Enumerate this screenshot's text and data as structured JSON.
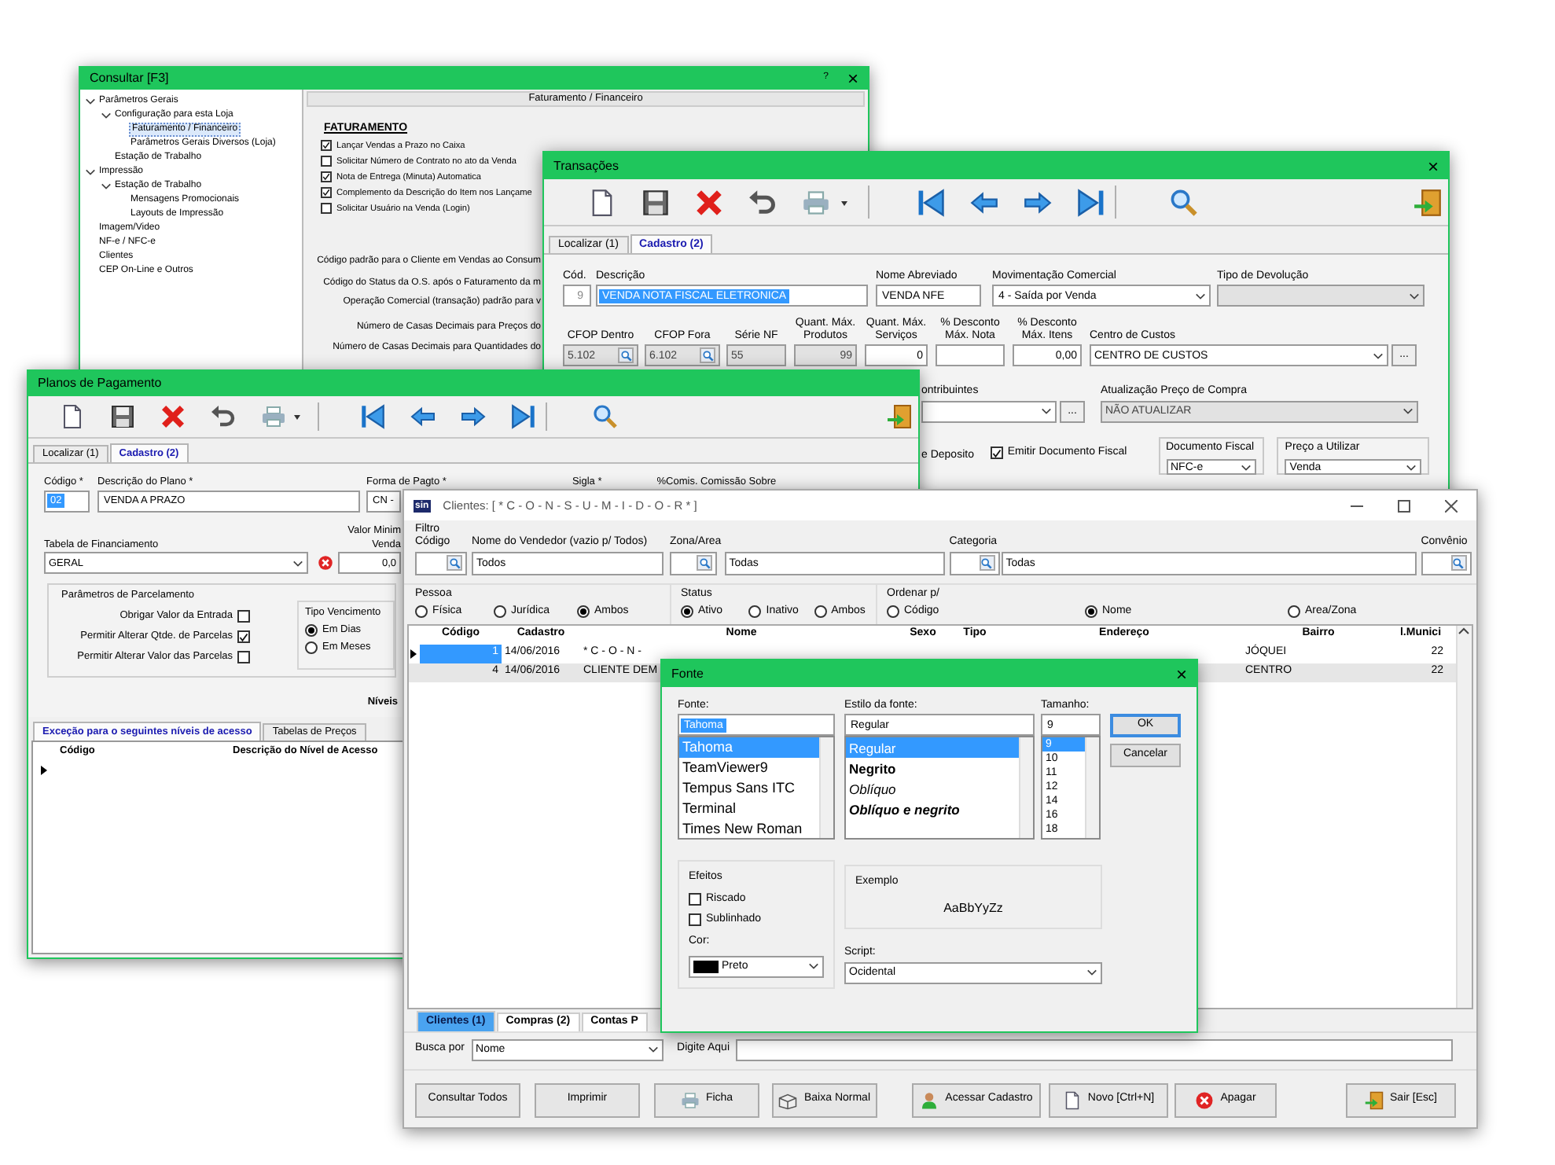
{
  "consultar": {
    "title": "Consultar [F3]",
    "help": "?",
    "close": "×",
    "tree": [
      {
        "label": "Parâmetros Gerais",
        "expanded": true,
        "selected": false,
        "children": [
          {
            "label": "Configuração para esta Loja",
            "expanded": true,
            "selected": false,
            "children": [
              {
                "label": "Faturamento / Financeiro",
                "selected": true
              },
              {
                "label": "Parâmetros Gerais Diversos (Loja)",
                "selected": false
              }
            ]
          },
          {
            "label": "Estação de Trabalho",
            "selected": false
          }
        ]
      },
      {
        "label": "Impressão",
        "expanded": true,
        "selected": false,
        "children": [
          {
            "label": "Estação de Trabalho",
            "expanded": true,
            "selected": false,
            "children": [
              {
                "label": "Mensagens Promocionais",
                "selected": false
              },
              {
                "label": "Layouts de Impressão",
                "selected": false
              }
            ]
          }
        ]
      },
      {
        "label": "Imagem/Video",
        "selected": false
      },
      {
        "label": "NF-e / NFC-e",
        "selected": false
      },
      {
        "label": "Clientes",
        "selected": false
      },
      {
        "label": "CEP On-Line e Outros",
        "selected": false
      }
    ],
    "panel_title": "Faturamento / Financeiro",
    "section": "FATURAMENTO",
    "options": [
      {
        "label": "Lançar Vendas a Prazo no Caixa",
        "checked": true
      },
      {
        "label": "Solicitar Número de Contrato no ato da Venda",
        "checked": false
      },
      {
        "label": "Nota de Entrega (Minuta) Automatica",
        "checked": true
      },
      {
        "label": "Complemento da Descrição do Item nos Lançame",
        "checked": true
      },
      {
        "label": "Solicitar Usuário na Venda (Login)",
        "checked": false
      }
    ],
    "settings": [
      "Código padrão para o Cliente em Vendas ao Consum",
      "Código do Status da O.S. após o Faturamento da m",
      "Operação Comercial (transação) padrão para v",
      "Número de Casas Decimais para Preços do",
      "Número de Casas Decimais para Quantidades do"
    ]
  },
  "transacoes": {
    "title": "Transações",
    "close": "×",
    "tabs": [
      {
        "label": "Localizar (1)",
        "selected": false
      },
      {
        "label": "Cadastro (2)",
        "selected": true
      }
    ],
    "row_1": [
      {
        "label": "Cód.",
        "value": "9",
        "kind": "readonly",
        "disabled": false,
        "highlighted": false
      },
      {
        "label": "Descrição",
        "value": "VENDA NOTA FISCAL ELETRONICA",
        "kind": "text",
        "disabled": false,
        "highlighted": true
      },
      {
        "label": "Nome Abreviado",
        "value": "VENDA NFE",
        "kind": "text",
        "disabled": false,
        "highlighted": false
      },
      {
        "label": "Movimentação Comercial",
        "value": "4 - Saída por Venda",
        "kind": "select",
        "disabled": false,
        "highlighted": false
      },
      {
        "label": "Tipo de Devolução",
        "kind": "select",
        "disabled": true
      }
    ],
    "row_2": [
      {
        "label": "CFOP Dentro",
        "value": "5.102",
        "kind": "lookup",
        "disabled": true
      },
      {
        "label": "CFOP Fora",
        "value": "6.102",
        "kind": "lookup",
        "disabled": true
      },
      {
        "label": "Série NF",
        "value": "55",
        "kind": "text",
        "disabled": true
      },
      {
        "label": "Quant. Máx. Produtos",
        "value": "99",
        "kind": "number",
        "disabled": true
      },
      {
        "label": "Quant. Máx. Serviços",
        "value": "0",
        "kind": "number",
        "disabled": false
      },
      {
        "label": "% Desconto Máx. Nota",
        "kind": "number",
        "disabled": false
      },
      {
        "label": "% Desconto Máx. Itens",
        "value": "0,00",
        "kind": "number",
        "disabled": false
      },
      {
        "label": "Centro de Custos",
        "value": "CENTRO DE CUSTOS",
        "kind": "select",
        "disabled": false,
        "button": "..."
      }
    ],
    "row_3": [
      {
        "label": "ontribuintes",
        "kind": "select",
        "disabled": false,
        "button": "..."
      },
      {
        "label": "Atualização Preço de Compra",
        "value": "NÃO ATUALIZAR",
        "kind": "select",
        "disabled": true
      }
    ],
    "row_4": {
      "caption": "e Deposito",
      "checkbox": {
        "label": "Emitir Documento Fiscal",
        "checked": true
      },
      "groups": [
        {
          "label": "Documento Fiscal",
          "value": "NFC-e"
        },
        {
          "label": "Preço a Utilizar",
          "value": "Venda"
        }
      ]
    }
  },
  "planos": {
    "title": "Planos de Pagamento",
    "tabs": [
      {
        "label": "Localizar (1)",
        "selected": false
      },
      {
        "label": "Cadastro (2)",
        "selected": true
      }
    ],
    "row_1": [
      {
        "label": "Código *",
        "value": "02",
        "kind": "text",
        "highlighted": true
      },
      {
        "label": "Descrição do Plano *",
        "value": "VENDA A PRAZO",
        "kind": "text",
        "highlighted": false
      },
      {
        "label": "Forma de Pagto *",
        "value": "CN -",
        "kind": "text",
        "highlighted": false
      }
    ],
    "captions": [
      "Sigla *",
      "%Comis. Comissão Sobre"
    ],
    "financing": {
      "label": "Tabela de Financiamento",
      "value": "GERAL"
    },
    "minimum": {
      "label": "Valor Minim",
      "label_2": "Venda",
      "value": "0,0"
    },
    "installments": {
      "title": "Parâmetros de Parcelamento",
      "options": [
        {
          "label": "Obrigar Valor da Entrada",
          "checked": false
        },
        {
          "label": "Permitir Alterar Qtde. de Parcelas",
          "checked": true
        },
        {
          "label": "Permitir Alterar Valor das Parcelas",
          "checked": false
        }
      ],
      "due": {
        "title": "Tipo Vencimento",
        "options": [
          {
            "label": "Em Dias",
            "selected": true
          },
          {
            "label": "Em Meses",
            "selected": false
          }
        ]
      }
    },
    "levels_caption": "Níveis",
    "lower_tabs": [
      {
        "label": "Exceção para o seguintes níveis de acesso",
        "selected": true
      },
      {
        "label": "Tabelas de Preços",
        "selected": false
      }
    ],
    "grid_columns": [
      "Código",
      "Descrição do Nível de Acesso"
    ]
  },
  "clientes": {
    "logo": "sin",
    "title": "Clientes: [ * C - O - N - S - U - M - I - D - O - R * ]",
    "filter_title": "Filtro",
    "filters": [
      {
        "label": "Código",
        "kind": "lookup"
      },
      {
        "label": "Nome do Vendedor (vazio p/ Todos)",
        "value": "Todos",
        "kind": "text"
      },
      {
        "label": "Zona/Area",
        "kind": "lookup"
      },
      {
        "value": "Todas",
        "kind": "text"
      },
      {
        "label": "Categoria",
        "kind": "lookup"
      },
      {
        "value": "Todas",
        "kind": "text"
      },
      {
        "label": "Convênio",
        "kind": "lookup"
      }
    ],
    "radio_groups": [
      {
        "label": "Pessoa",
        "options": [
          {
            "label": "Física",
            "selected": false
          },
          {
            "label": "Jurídica",
            "selected": false
          },
          {
            "label": "Ambos",
            "selected": true
          }
        ]
      },
      {
        "label": "Status",
        "options": [
          {
            "label": "Ativo",
            "selected": true
          },
          {
            "label": "Inativo",
            "selected": false
          },
          {
            "label": "Ambos",
            "selected": false
          }
        ]
      },
      {
        "label": "Ordenar p/",
        "options": [
          {
            "label": "Código",
            "selected": false
          },
          {
            "label": "Nome",
            "selected": true
          },
          {
            "label": "Area/Zona",
            "selected": false
          }
        ]
      }
    ],
    "grid": {
      "columns": [
        "Código",
        "Cadastro",
        "Nome",
        "Sexo",
        "Tipo",
        "Endereço",
        "Bairro",
        "l.Munici"
      ],
      "rows": [
        {
          "selected": true,
          "cells": [
            "1",
            "14/06/2016",
            "* C - O - N -",
            "JÓQUEI",
            "22"
          ]
        },
        {
          "selected": false,
          "cells": [
            "4",
            "14/06/2016",
            "CLIENTE DEM",
            "CENTRO",
            "22"
          ]
        }
      ]
    },
    "tabs": [
      {
        "label": "Clientes (1)",
        "selected": true
      },
      {
        "label": "Compras (2)",
        "selected": false
      },
      {
        "label": "Contas P",
        "selected": false
      }
    ],
    "search": {
      "label": "Busca por",
      "value": "Nome",
      "input_label": "Digite Aqui"
    },
    "buttons": [
      {
        "label": "Consultar Todos",
        "kind": "plain"
      },
      {
        "label": "Imprimir",
        "kind": "plain"
      },
      {
        "label": "Ficha",
        "kind": "printer"
      },
      {
        "label": "Baixa Normal",
        "kind": "box"
      },
      {
        "label": "Acessar Cadastro",
        "kind": "person"
      },
      {
        "label": "Novo [Ctrl+N]",
        "kind": "document"
      },
      {
        "label": "Apagar",
        "kind": "delete"
      },
      {
        "label": "Sair [Esc]",
        "kind": "exit"
      }
    ]
  },
  "fonte": {
    "title": "Fonte",
    "close": "×",
    "font": {
      "label": "Fonte:",
      "value": "Tahoma",
      "highlighted": true,
      "items": [
        {
          "label": "Tahoma",
          "selected": true
        },
        {
          "label": "TeamViewer9",
          "selected": false
        },
        {
          "label": "Tempus Sans ITC",
          "selected": false
        },
        {
          "label": "Terminal",
          "selected": false
        },
        {
          "label": "Times New Roman",
          "selected": false
        }
      ]
    },
    "style": {
      "label": "Estilo da fonte:",
      "value": "Regular",
      "highlighted": false,
      "items": [
        {
          "label": "Regular",
          "selected": true,
          "kind": "regular"
        },
        {
          "label": "Negrito",
          "selected": false,
          "kind": "bold"
        },
        {
          "label": "Oblíquo",
          "selected": false,
          "kind": "italic"
        },
        {
          "label": "Oblíquo e negrito",
          "selected": false,
          "kind": "bold-italic"
        }
      ]
    },
    "size": {
      "label": "Tamanho:",
      "value": "9",
      "highlighted": false,
      "items": [
        {
          "label": "9",
          "selected": true
        },
        {
          "label": "10",
          "selected": false
        },
        {
          "label": "11",
          "selected": false
        },
        {
          "label": "12",
          "selected": false
        },
        {
          "label": "14",
          "selected": false
        },
        {
          "label": "16",
          "selected": false
        },
        {
          "label": "18",
          "selected": false
        }
      ]
    },
    "buttons": [
      {
        "label": "OK",
        "default": true
      },
      {
        "label": "Cancelar",
        "default": false
      }
    ],
    "effects": {
      "title": "Efeitos",
      "options": [
        {
          "label": "Riscado",
          "checked": false
        },
        {
          "label": "Sublinhado",
          "checked": false
        }
      ],
      "color_label": "Cor:",
      "color": {
        "value": "Preto"
      }
    },
    "sample": {
      "title": "Exemplo",
      "text": "AaBbYyZz"
    },
    "script": {
      "label": "Script:",
      "value": "Ocidental"
    }
  }
}
